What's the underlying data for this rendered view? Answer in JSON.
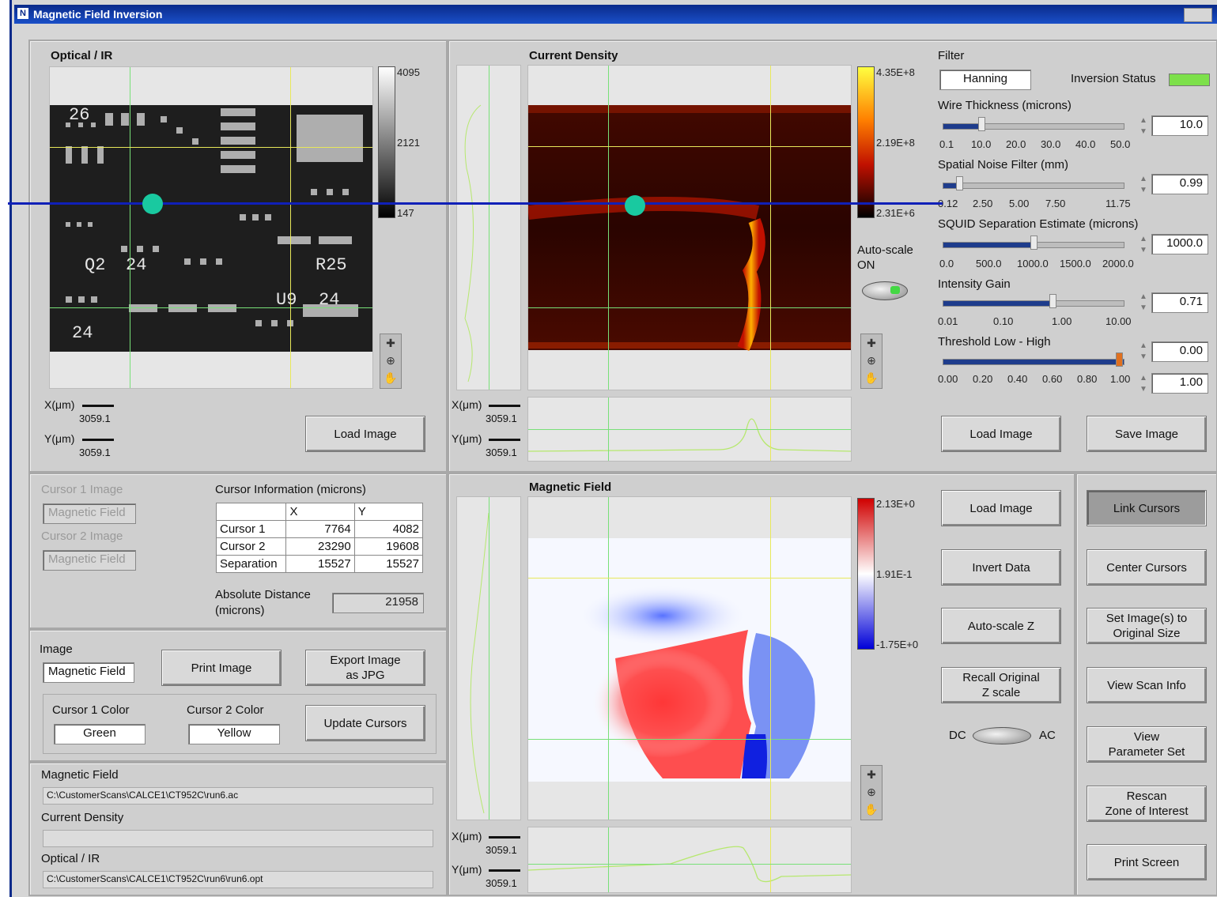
{
  "window": {
    "title": "Magnetic Field Inversion",
    "icon": "N"
  },
  "optical": {
    "title": "Optical / IR",
    "scale_ticks": [
      "4095",
      "2121",
      "147"
    ],
    "board_labels": [
      "26",
      "Q2",
      "24",
      "R25",
      "U9",
      "24",
      "24"
    ],
    "x_label": "X(μm)",
    "x_value": "3059.1",
    "y_label": "Y(μm)",
    "y_value": "3059.1",
    "load_button": "Load Image"
  },
  "current_density": {
    "title": "Current Density",
    "scale_ticks": [
      "4.35E+8",
      "2.19E+8",
      "2.31E+6"
    ],
    "autoscale_label": "Auto-scale",
    "autoscale_state": "ON",
    "x_label": "X(μm)",
    "x_value": "3059.1",
    "y_label": "Y(μm)",
    "y_value": "3059.1"
  },
  "controls": {
    "filter_label": "Filter",
    "filter_value": "Hanning",
    "inversion_status_label": "Inversion Status",
    "inversion_status_color": "#7de04a",
    "wire_thickness": {
      "label": "Wire Thickness (microns)",
      "value": "10.0",
      "ticks": [
        "0.1",
        "10.0",
        "20.0",
        "30.0",
        "40.0",
        "50.0"
      ],
      "fraction": 0.2
    },
    "spatial_noise": {
      "label": "Spatial Noise Filter (mm)",
      "value": "0.99",
      "ticks": [
        "0.12",
        "2.50",
        "5.00",
        "7.50",
        "11.75"
      ],
      "fraction": 0.08
    },
    "squid_sep": {
      "label": "SQUID Separation Estimate (microns)",
      "value": "1000.0",
      "ticks": [
        "0.0",
        "500.0",
        "1000.0",
        "1500.0",
        "2000.0"
      ],
      "fraction": 0.5
    },
    "intensity_gain": {
      "label": "Intensity Gain",
      "value": "0.71",
      "ticks": [
        "0.01",
        "0.10",
        "1.00",
        "10.00"
      ],
      "fraction": 0.6
    },
    "threshold": {
      "label": "Threshold Low - High",
      "low": "0.00",
      "high": "1.00",
      "ticks": [
        "0.00",
        "0.20",
        "0.40",
        "0.60",
        "0.80",
        "1.00"
      ],
      "fraction": 1.0
    },
    "load_button": "Load Image",
    "save_button": "Save Image"
  },
  "cursor_panel": {
    "cursor1_image_label": "Cursor 1 Image",
    "cursor1_image_value": "Magnetic Field",
    "cursor2_image_label": "Cursor 2 Image",
    "cursor2_image_value": "Magnetic Field",
    "info_title": "Cursor Information (microns)",
    "columns": [
      "",
      "X",
      "Y"
    ],
    "rows": [
      {
        "name": "Cursor 1",
        "x": "7764",
        "y": "4082"
      },
      {
        "name": "Cursor 2",
        "x": "23290",
        "y": "19608"
      },
      {
        "name": "Separation",
        "x": "15527",
        "y": "15527"
      }
    ],
    "abs_distance_label_1": "Absolute Distance",
    "abs_distance_label_2": "(microns)",
    "abs_distance_value": "21958"
  },
  "image_panel": {
    "image_label": "Image",
    "image_value": "Magnetic Field",
    "print_button": "Print Image",
    "export_button_1": "Export Image",
    "export_button_2": "as JPG",
    "cursor1_color_label": "Cursor 1 Color",
    "cursor1_color_value": "Green",
    "cursor2_color_label": "Cursor 2 Color",
    "cursor2_color_value": "Yellow",
    "update_button": "Update Cursors"
  },
  "files_panel": {
    "magnetic_label": "Magnetic Field",
    "magnetic_path": "C:\\CustomerScans\\CALCE1\\CT952C\\run6.ac",
    "current_label": "Current Density",
    "current_path": "",
    "optical_label": "Optical / IR",
    "optical_path": "C:\\CustomerScans\\CALCE1\\CT952C\\run6\\run6.opt"
  },
  "magnetic": {
    "title": "Magnetic Field",
    "scale_ticks": [
      "2.13E+0",
      "1.91E-1",
      "-1.75E+0"
    ],
    "x_label": "X(μm)",
    "x_value": "3059.1",
    "y_label": "Y(μm)",
    "y_value": "3059.1"
  },
  "mid_buttons": {
    "load": "Load Image",
    "invert": "Invert Data",
    "autoscale": "Auto-scale Z",
    "recall_1": "Recall Original",
    "recall_2": "Z scale",
    "dc": "DC",
    "ac": "AC"
  },
  "right_buttons": {
    "link": "Link Cursors",
    "center": "Center Cursors",
    "set_1": "Set Image(s) to",
    "set_2": "Original Size",
    "view_scan": "View Scan Info",
    "view_param_1": "View",
    "view_param_2": "Parameter Set",
    "rescan_1": "Rescan",
    "rescan_2": "Zone of Interest",
    "print": "Print Screen"
  },
  "colors": {
    "cursor1": "#7be07b",
    "cursor2": "#e8e85a",
    "link_line": "#1020b8",
    "marker": "#19c9a0"
  }
}
